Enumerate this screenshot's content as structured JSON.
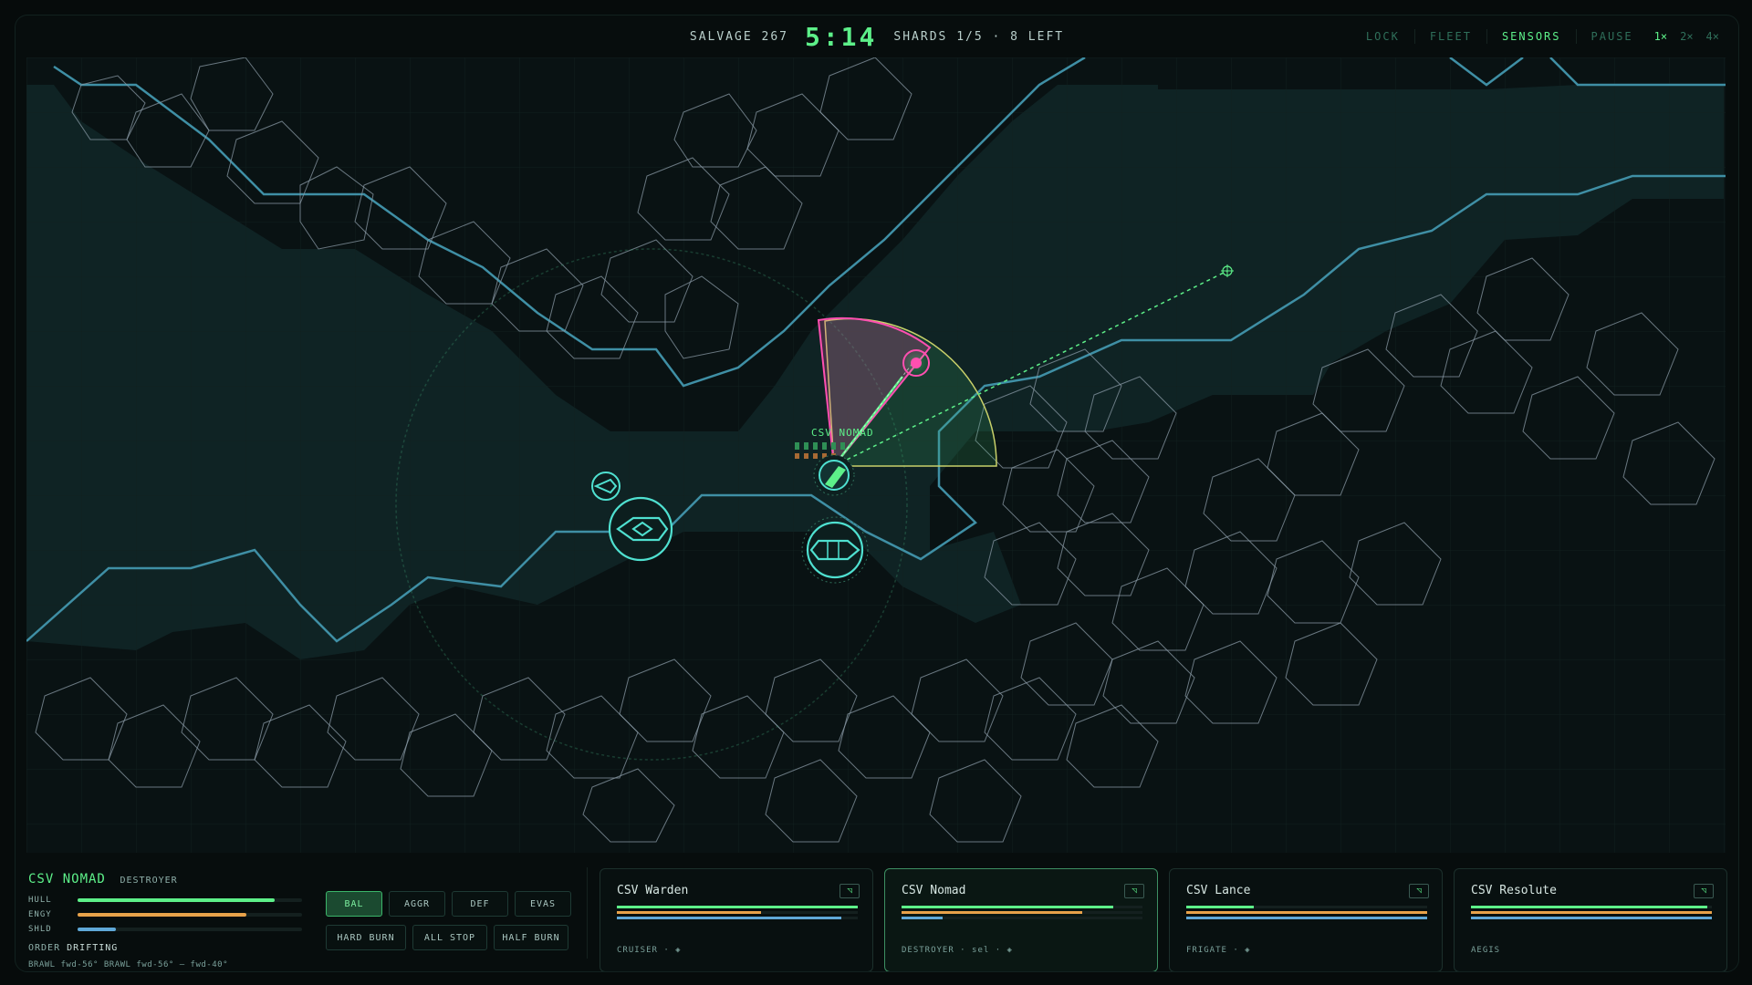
{
  "topbar": {
    "salvage": "SALVAGE 267",
    "timer": "5:14",
    "shards": "SHARDS 1/5 · 8 LEFT",
    "controls": [
      "LOCK",
      "FLEET",
      "SENSORS",
      "PAUSE"
    ],
    "active_control": "SENSORS",
    "speeds": [
      "1×",
      "2×",
      "4×"
    ],
    "active_speed": "1×"
  },
  "map": {
    "ship_label": "CSV NOMAD",
    "colors": {
      "accent": "#5df089",
      "cyan": "#4fe0d0",
      "enemy": "#ff4fb0",
      "terrain_edge": "#3f8fa5",
      "asteroid": "#8a9aa6"
    }
  },
  "selected_ship": {
    "name": "CSV NOMAD",
    "class": "DESTROYER",
    "stats": [
      {
        "label": "HULL",
        "value": 0.88,
        "color": "#5df089"
      },
      {
        "label": "ENGY",
        "value": 0.75,
        "color": "#e8a24a"
      },
      {
        "label": "SHLD",
        "value": 0.17,
        "color": "#5fa8d8"
      }
    ],
    "order_label": "ORDER",
    "order_value": "DRIFTING",
    "weapons": "BRAWL fwd-56° BRAWL fwd-56° — fwd-40°"
  },
  "stances": {
    "row1": [
      "BAL",
      "AGGR",
      "DEF",
      "EVAS"
    ],
    "row2": [
      "HARD BURN",
      "ALL STOP",
      "HALF BURN"
    ],
    "active": "BAL"
  },
  "fleet": [
    {
      "name": "CSV Warden",
      "sub": "CRUISER · ◈",
      "hull": 1.0,
      "engy": 0.6,
      "shld": 0.93,
      "icon": "◹"
    },
    {
      "name": "CSV Nomad",
      "sub": "DESTROYER · sel · ◈",
      "hull": 0.88,
      "engy": 0.75,
      "shld": 0.17,
      "icon": "◹",
      "selected": true
    },
    {
      "name": "CSV Lance",
      "sub": "FRIGATE · ◈",
      "hull": 0.28,
      "engy": 1.0,
      "shld": 1.0,
      "icon": "◹"
    },
    {
      "name": "CSV Resolute",
      "sub": "AEGIS",
      "hull": 0.98,
      "engy": 1.0,
      "shld": 1.0,
      "icon": "◹"
    }
  ]
}
